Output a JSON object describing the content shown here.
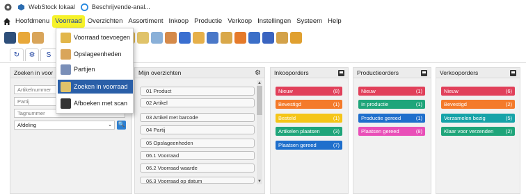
{
  "bookmarks": [
    {
      "label": "",
      "icon": "chrome-icon"
    },
    {
      "label": "WebStock lokaal",
      "icon": "cube-icon"
    },
    {
      "label": "Beschrijvende-anal...",
      "icon": "circle-icon"
    }
  ],
  "menu": {
    "items": [
      "Hoofdmenu",
      "Voorraad",
      "Overzichten",
      "Assortiment",
      "Inkoop",
      "Productie",
      "Verkoop",
      "Instellingen",
      "Systeem",
      "Help"
    ],
    "active": "Voorraad",
    "highlight_color": "#f6f22a"
  },
  "dropdown": {
    "items": [
      {
        "label": "Voorraad toevoegen",
        "icon": "add-stock-icon"
      },
      {
        "label": "Opslageenheden",
        "icon": "storage-units-icon"
      },
      {
        "label": "Partijen",
        "icon": "batches-icon"
      },
      {
        "label": "Zoeken in voorraad",
        "icon": "search-stock-icon",
        "highlighted": true
      },
      {
        "label": "Afboeken met scan",
        "icon": "scanner-icon"
      }
    ]
  },
  "tabs": [
    {
      "icon": "refresh-icon",
      "label": "↻"
    },
    {
      "icon": "gear-icon",
      "label": "⚙"
    },
    {
      "icon": "tab-s",
      "label": "S"
    }
  ],
  "search_panel": {
    "title": "Zoeken in voor",
    "fields": [
      {
        "placeholder": "Artikelnummer"
      },
      {
        "placeholder": "Partij"
      },
      {
        "placeholder": "Tagnummer"
      }
    ],
    "select_value": "Afdeling"
  },
  "overviews": {
    "title": "Mijn overzichten",
    "items": [
      "01 Product",
      "02 Artikel",
      "03 Artikel met barcode",
      "04 Partij",
      "05 Opslageenheden",
      "06.1 Voorraad",
      "06.2 Voorraad waarde",
      "06.3 Voorraad op datum"
    ]
  },
  "inkooporders": {
    "title": "Inkooporders",
    "badges": [
      {
        "label": "Nieuw",
        "count": "(8)",
        "color": "#e1405a"
      },
      {
        "label": "Bevestigd",
        "count": "(1)",
        "color": "#f47a2a"
      },
      {
        "label": "Besteld",
        "count": "(1)",
        "color": "#f5c518"
      },
      {
        "label": "Artikelen plaatsen",
        "count": "(3)",
        "color": "#1fa57a"
      },
      {
        "label": "Plaatsen gereed",
        "count": "(7)",
        "color": "#1f6fcc"
      }
    ]
  },
  "productieorders": {
    "title": "Productieorders",
    "badges": [
      {
        "label": "Nieuw",
        "count": "(1)",
        "color": "#e1405a"
      },
      {
        "label": "In productie",
        "count": "(1)",
        "color": "#1fa57a"
      },
      {
        "label": "Productie gereed",
        "count": "(1)",
        "color": "#1f6fcc"
      },
      {
        "label": "Plaatsen gereed",
        "count": "(8)",
        "color": "#e94fb8"
      }
    ]
  },
  "verkooporders": {
    "title": "Verkooporders",
    "badges": [
      {
        "label": "Nieuw",
        "count": "(6)",
        "color": "#e1405a"
      },
      {
        "label": "Bevestigd",
        "count": "(2)",
        "color": "#f47a2a"
      },
      {
        "label": "Verzamelen bezig",
        "count": "(5)",
        "color": "#16a3a8"
      },
      {
        "label": "Klaar voor verzenden",
        "count": "(2)",
        "color": "#1fa57a"
      }
    ]
  }
}
